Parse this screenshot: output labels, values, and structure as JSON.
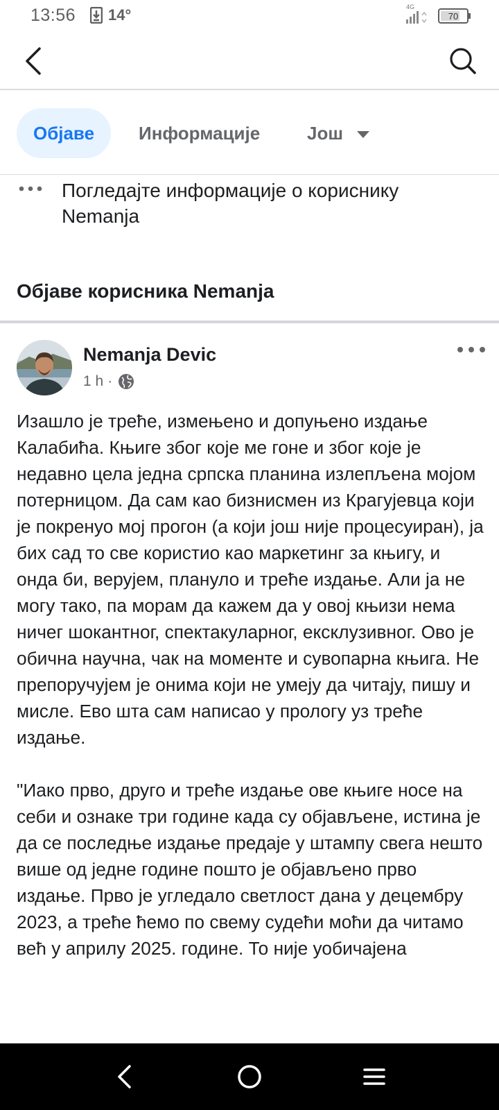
{
  "status_bar": {
    "time": "13:56",
    "temperature": "14°",
    "network": "4G",
    "battery": "70"
  },
  "app_bar": {
    "back_icon": "chevron-left-icon",
    "search_icon": "search-icon"
  },
  "tabs": [
    {
      "label": "Објаве",
      "active": true
    },
    {
      "label": "Информације",
      "active": false
    },
    {
      "label": "Још",
      "active": false
    }
  ],
  "info_link": {
    "text": "Погледајте информације о кориснику Nemanja"
  },
  "section": {
    "title": "Објаве корисника Nemanja"
  },
  "post": {
    "author": "Nemanja Devic",
    "time": "1 h",
    "separator": "·",
    "privacy_icon": "globe-icon",
    "body": "Изашло је треће, измењено и допуњено издање Калабића. Књиге због које ме гоне и због које је недавно цела једна српска планина излепљена мојом потерницом. Да сам као бизнисмен из Крагујевца који је покренуо мој прогон (а који још није процесуиран), ја бих сад то све користио као маркетинг за књигу, и онда би, верујем, плануло и треће издање. Али ја не могу тако, па морам да кажем да у овој књизи нема ничег шокантног, спектакуларног, ексклузивног. Ово је обична научна, чак на моменте и сувопарна књига. Не препоручујем је онима који не умеју да читају, пишу и мисле. Ево шта сам написао у прологу уз треће издање.\n\n\"Иако прво, друго и треће издање ове књиге носе на себи и ознаке три године када су објављене, истина је да се последње издање предаје у штампу свега нешто више од једне године пошто је објављено прво издање. Прво је угледало светлост дана у децембру 2023, а треће ћемо по свему судећи моћи да читамо већ у априлу 2025. године. То није уобичајена"
  },
  "nav_bar": {
    "back_icon": "triangle-back-icon",
    "home_icon": "circle-home-icon",
    "menu_icon": "menu-icon"
  },
  "colors": {
    "accent": "#1877f2",
    "active_tab_bg": "#e7f3ff",
    "secondary_text": "#65676b",
    "divider": "#d4d6da"
  }
}
